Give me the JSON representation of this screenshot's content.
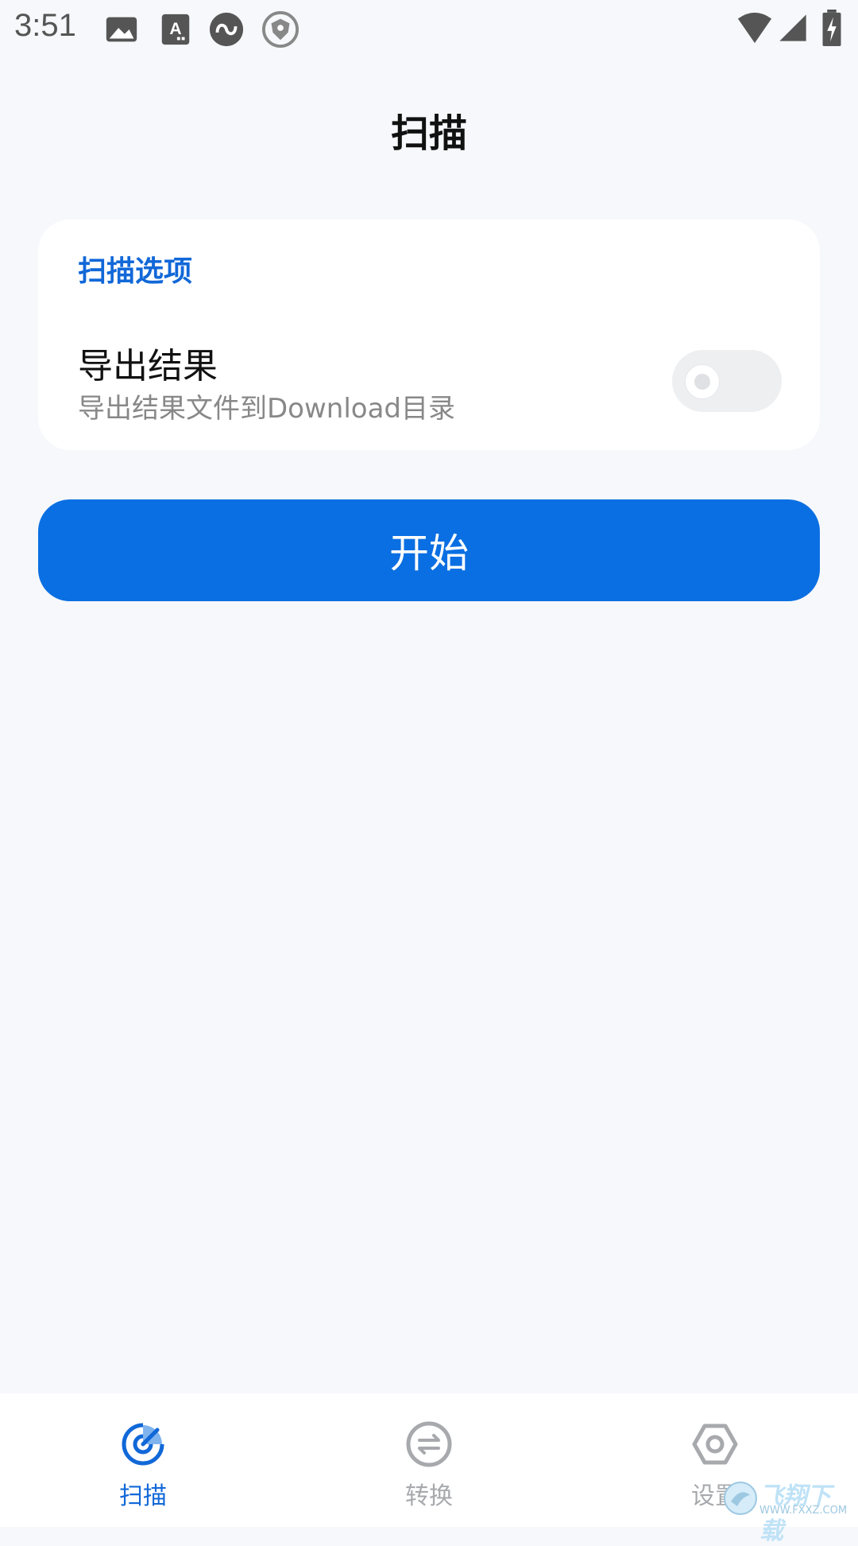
{
  "status_bar": {
    "time": "3:51",
    "icons_left": [
      "image-icon",
      "keyboard-a-icon",
      "vpn-infinity-icon",
      "shield-icon"
    ],
    "icons_right": [
      "wifi-icon",
      "signal-icon",
      "battery-charging-icon"
    ]
  },
  "header": {
    "title": "扫描"
  },
  "scan_options": {
    "header": "扫描选项",
    "export": {
      "title": "导出结果",
      "description": "导出结果文件到Download目录",
      "enabled": false
    }
  },
  "start_button": {
    "label": "开始"
  },
  "bottom_nav": {
    "items": [
      {
        "label": "扫描",
        "icon": "scan-icon",
        "active": true
      },
      {
        "label": "转换",
        "icon": "convert-icon",
        "active": false
      },
      {
        "label": "设置",
        "icon": "settings-icon",
        "active": false
      }
    ]
  },
  "watermark": {
    "text": "飞翔下载",
    "url": "WWW.FXXZ.COM"
  },
  "colors": {
    "accent": "#0a6fe2",
    "header_accent": "#1168d8",
    "background": "#f6f8fb",
    "inactive": "#a7a9ad"
  }
}
